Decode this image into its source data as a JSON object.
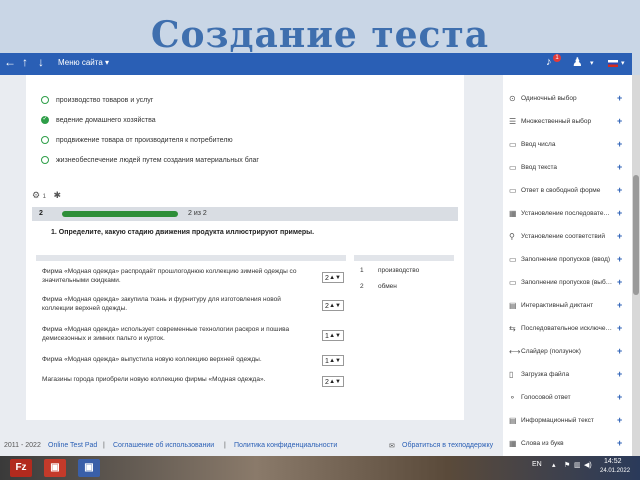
{
  "slide_title": "Создание теста",
  "topbar": {
    "menu_label": "Меню сайта",
    "notification_count": "1"
  },
  "answers": [
    {
      "text": "производство товаров и услуг",
      "checked": false
    },
    {
      "text": "ведение домашнего хозяйства",
      "checked": true
    },
    {
      "text": "продвижение товара от производителя к потребителю",
      "checked": false
    },
    {
      "text": "жизнеобеспечение людей путем создания материальных благ",
      "checked": false
    }
  ],
  "question": {
    "number": "2",
    "progress_percent": 100,
    "count_text": "2 из 2",
    "text": "1. Определите, какую стадию движения продукта иллюстрируют примеры."
  },
  "statements": [
    {
      "text": "Фирма «Модная одежда» распродаёт прошлогоднюю коллекцию зимней одежды со значительными скидками.",
      "value": "2"
    },
    {
      "text": "Фирма «Модная одежда» закупила ткань и фурнитуру для изготовления новой коллекции верхней одежды.",
      "value": "2"
    },
    {
      "text": "Фирма «Модная одежда» использует современные технологии раскроя и пошива демисезонных и зимних пальто и курток.",
      "value": "1"
    },
    {
      "text": "Фирма «Модная одежда» выпустила новую коллекцию верхней одежды.",
      "value": "1"
    },
    {
      "text": "Магазины города приобрели новую коллекцию фирмы «Модная одежда».",
      "value": "2"
    }
  ],
  "options": [
    {
      "n": "1",
      "text": "производство"
    },
    {
      "n": "2",
      "text": "обмен"
    }
  ],
  "footer": {
    "years": "2011 - 2022",
    "brand": "Online Test Pad",
    "agreement": "Соглашение об использовании",
    "privacy": "Политика конфиденциальности",
    "support": "Обратиться в техподдержку"
  },
  "sidebar": [
    {
      "icon": "⊙",
      "label": "Одиночный выбор"
    },
    {
      "icon": "☰",
      "label": "Множественный выбор"
    },
    {
      "icon": "▭",
      "label": "Ввод числа"
    },
    {
      "icon": "▭",
      "label": "Ввод текста"
    },
    {
      "icon": "▭",
      "label": "Ответ в свободной форме"
    },
    {
      "icon": "▦",
      "label": "Установление последовательности"
    },
    {
      "icon": "⚲",
      "label": "Установление соответствий"
    },
    {
      "icon": "▭",
      "label": "Заполнение пропусков (ввод)"
    },
    {
      "icon": "▭",
      "label": "Заполнение пропусков (выбор)"
    },
    {
      "icon": "▤",
      "label": "Интерактивный диктант"
    },
    {
      "icon": "⇆",
      "label": "Последовательное исключение"
    },
    {
      "icon": "⟷",
      "label": "Слайдер (ползунок)"
    },
    {
      "icon": "▯",
      "label": "Загрузка файла"
    },
    {
      "icon": "⚬",
      "label": "Голосовой ответ"
    },
    {
      "icon": "▤",
      "label": "Информационный текст"
    },
    {
      "icon": "▦",
      "label": "Слова из букв"
    }
  ],
  "taskbar": {
    "buttons": [
      {
        "glyph": "Fz",
        "color": "#b22a1e"
      },
      {
        "glyph": "▣",
        "color": "#c43a2a"
      },
      {
        "glyph": "▣",
        "color": "#3a5fa8"
      }
    ],
    "lang": "EN",
    "time": "14:52",
    "date": "24.01.2022"
  }
}
